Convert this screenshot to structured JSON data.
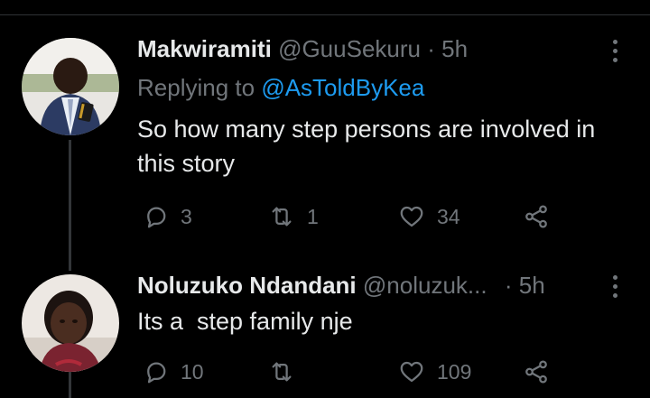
{
  "tweets": [
    {
      "name": "Makwiramiti",
      "handle": "@GuuSekuru",
      "separator": "·",
      "time": "5h",
      "replying_prefix": "Replying to",
      "replying_mention": "@AsToldByKea",
      "text": "So how many step persons are involved in this story",
      "replies": "3",
      "retweets": "1",
      "likes": "34"
    },
    {
      "name": "Noluzuko Ndandani",
      "handle": "@noluzuk...",
      "separator": "·",
      "time": "5h",
      "text": "Its a  step family nje",
      "replies": "10",
      "retweets": "",
      "likes": "109"
    }
  ],
  "icons": {
    "reply": "reply-icon",
    "retweet": "retweet-icon",
    "like": "heart-icon",
    "share": "share-icon",
    "more": "more-vertical-icon"
  },
  "colors": {
    "background": "#000000",
    "primary_text": "#e7e9ea",
    "secondary_text": "#71767b",
    "mention": "#1d9bf0",
    "thread_line": "#333639"
  }
}
